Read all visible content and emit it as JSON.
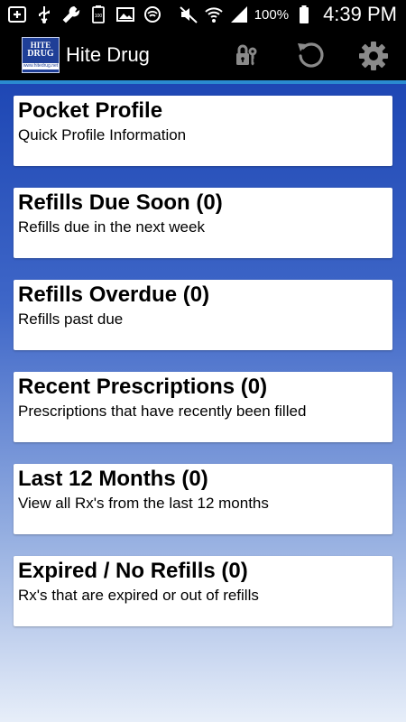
{
  "status_bar": {
    "left_icons": [
      "add-icon",
      "usb-icon",
      "wrench-icon",
      "battery-100-icon",
      "image-icon",
      "cast-icon"
    ],
    "right_icons": [
      "mute-icon",
      "wifi-icon",
      "signal-icon",
      "battery-icon"
    ],
    "battery_percent": "100%",
    "time": "4:39 PM"
  },
  "action_bar": {
    "title": "Hite Drug",
    "logo": {
      "line1": "HITE",
      "line2": "DRUG",
      "strip": "www.hitedrug.net"
    },
    "actions": [
      "lock-key-icon",
      "refresh-icon",
      "settings-icon"
    ]
  },
  "colors": {
    "action_bar_bg": "#000000",
    "accent_line": "#2a8bd0",
    "gradient_top": "#1e47b4",
    "gradient_bottom": "#e7eef9",
    "card_bg": "#ffffff"
  },
  "menu": [
    {
      "title": "Pocket Profile",
      "subtitle": "Quick Profile Information"
    },
    {
      "title": "Refills Due Soon (0)",
      "subtitle": "Refills due in the next week"
    },
    {
      "title": "Refills Overdue (0)",
      "subtitle": "Refills past due"
    },
    {
      "title": "Recent Prescriptions (0)",
      "subtitle": "Prescriptions that have recently been filled"
    },
    {
      "title": "Last 12 Months (0)",
      "subtitle": "View all Rx's from the last 12 months"
    },
    {
      "title": "Expired / No Refills (0)",
      "subtitle": "Rx's that are expired or out of refills"
    }
  ]
}
